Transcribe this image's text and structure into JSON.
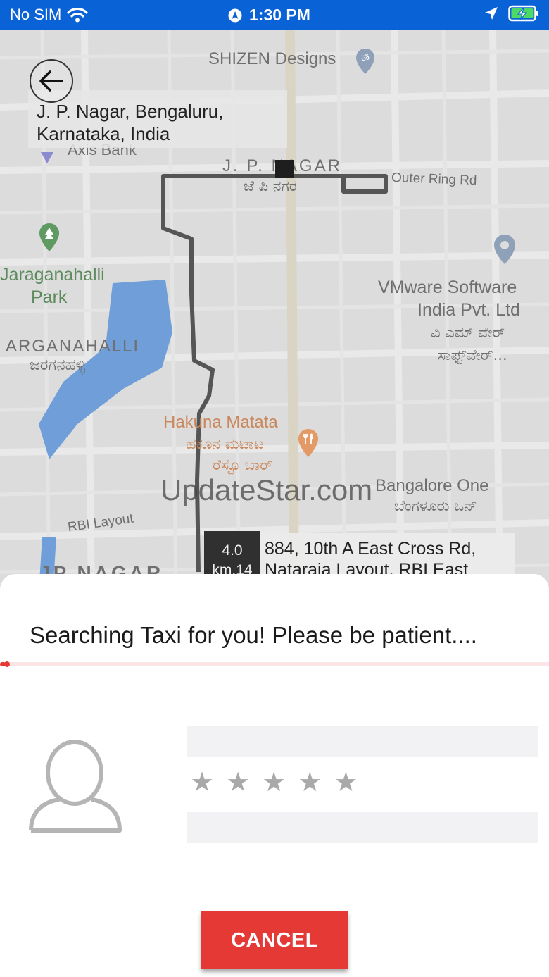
{
  "status_bar": {
    "carrier": "No SIM",
    "time": "1:30 PM"
  },
  "map": {
    "pickup_address_line1": "J. P. Nagar, Bengaluru,",
    "pickup_address_line2": "Karnataka, India",
    "labels": {
      "shizen": "SHIZEN Designs",
      "axis_bank": "Axis Bank",
      "jp_nagar": "J. P. NAGAR",
      "jp_nagar_kn": "ಜೆ ಪಿ ನಗರ",
      "outer_ring_rd": "Outer Ring Rd",
      "jaraganahalli_park_1": "Jaraganahalli",
      "jaraganahalli_park_2": "Park",
      "jarganahalli": "ARGANAHALLI",
      "jarganahalli_kn": "ಜರಗನಹಳ್ಳಿ",
      "vmware_1": "VMware Software",
      "vmware_2": "India Pvt. Ltd",
      "vmware_kn_1": "ವಿ ಎಮ್ ವೇರ್",
      "vmware_kn_2": "ಸಾಫ್ಟ್‌ವೇರ್...",
      "hakuna_1": "Hakuna Matata",
      "hakuna_kn_1": "ಹಕೂನ ಮಟಾಟ",
      "hakuna_kn_2": "ರೆಸ್ಟೊ ಬಾರ್",
      "bangalore_one": "Bangalore One",
      "bangalore_one_kn": "ಬೆಂಗಳೂರು ಒನ್",
      "rbi_layout": "RBI Layout",
      "jp_nagar_bottom": "JP NAGAR"
    },
    "eta_distance": "4.0",
    "eta_unit": "km.14",
    "origin_address_line1": "884, 10th A East Cross Rd,",
    "origin_address_line2": "Nataraja Layout, RBI East"
  },
  "watermark": "UpdateStar.com",
  "sheet": {
    "search_message": "Searching Taxi for you! Please be patient....",
    "progress_fraction": 0.01,
    "rating_stars": [
      "★",
      "★",
      "★",
      "★",
      "★"
    ],
    "cancel_label": "CANCEL"
  },
  "colors": {
    "status_bar": "#0a63d6",
    "accent": "#e53935",
    "map_bg": "#dcdcdc",
    "water": "#6f9ed8"
  },
  "icons": [
    "wifi-icon",
    "location-services-icon",
    "location-arrow-icon",
    "battery-charging-icon",
    "back-arrow-icon",
    "temple-pin-icon",
    "bank-pin-icon",
    "park-pin-icon",
    "place-pin-icon",
    "restaurant-pin-icon",
    "avatar-placeholder-icon",
    "star-icon"
  ]
}
